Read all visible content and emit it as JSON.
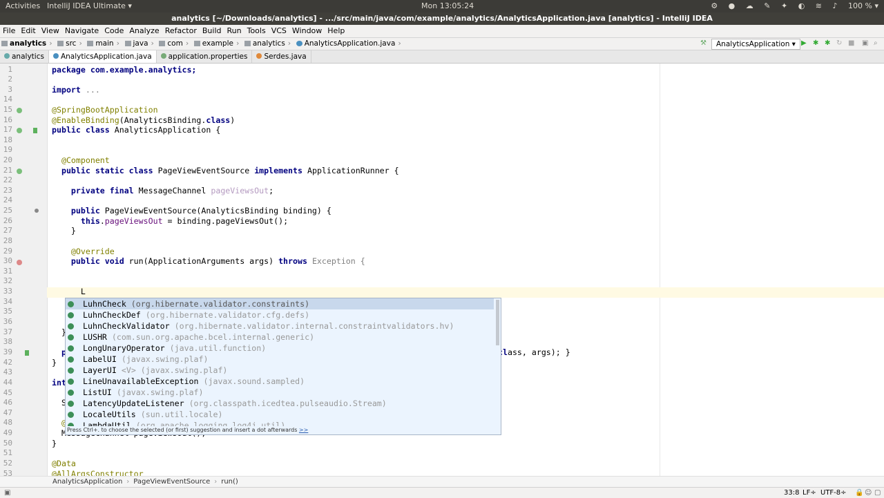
{
  "os_bar": {
    "activities": "Activities",
    "app": "IntelliJ IDEA Ultimate ▾",
    "clock": "Mon 13:05:24",
    "battery": "100 % ▾"
  },
  "window_title": "analytics [~/Downloads/analytics] - .../src/main/java/com/example/analytics/AnalyticsApplication.java [analytics] - IntelliJ IDEA",
  "menu": [
    "File",
    "Edit",
    "View",
    "Navigate",
    "Code",
    "Analyze",
    "Refactor",
    "Build",
    "Run",
    "Tools",
    "VCS",
    "Window",
    "Help"
  ],
  "breadcrumbs": [
    "analytics",
    "src",
    "main",
    "java",
    "com",
    "example",
    "analytics",
    "AnalyticsApplication.java"
  ],
  "run_config": "AnalyticsApplication ▾",
  "tabs": [
    {
      "label": "analytics"
    },
    {
      "label": "AnalyticsApplication.java"
    },
    {
      "label": "application.properties"
    },
    {
      "label": "Serdes.java"
    }
  ],
  "editor": {
    "line_numbers": [
      "1",
      "2",
      "3",
      "14",
      "15",
      "16",
      "17",
      "18",
      "19",
      "20",
      "21",
      "22",
      "23",
      "24",
      "25",
      "26",
      "27",
      "28",
      "29",
      "30",
      "31",
      "32",
      "33",
      "34",
      "35",
      "36",
      "37",
      "38",
      "39",
      "42",
      "43",
      "44",
      "45",
      "46",
      "47",
      "48",
      "49",
      "50",
      "51",
      "52",
      "53"
    ],
    "lines": {
      "l1": "package com.example.analytics;",
      "l3a": "import",
      "l3b": " ...",
      "l15": "@SpringBootApplication",
      "l16a": "@EnableBinding",
      "l16b": "(AnalyticsBinding.",
      "l16c": "class",
      "l16d": ")",
      "l17a": "public class",
      "l17b": " AnalyticsApplication {",
      "l20": "  @Component",
      "l21a": "  public static class",
      "l21b": " PageViewEventSource ",
      "l21c": "implements",
      "l21d": " ApplicationRunner {",
      "l23a": "    private final",
      "l23b": " MessageChannel ",
      "l23c": "pageViewsOut",
      "l23d": ";",
      "l25a": "    public",
      "l25b": " PageViewEventSource(AnalyticsBinding binding) {",
      "l26a": "      this",
      "l26b": ".",
      "l26c": "pageViewsOut",
      "l26d": " = binding.pageViewsOut();",
      "l27": "    }",
      "l29": "    @Override",
      "l30a": "    public void",
      "l30b": " run(ApplicationArguments args) ",
      "l30c": "throws",
      "l30d": " Exception {",
      "l33": "      L",
      "l37": "  }",
      "l39a": "  p",
      "l39b": "ass, args); }",
      "l42": "}",
      "l44": "int",
      "l46": "  S",
      "l48": "  @",
      "l49": "  MessageChannel pageViewsOut();",
      "l50": "}",
      "l52": "@Data",
      "l53": "@AllArgsConstructor"
    }
  },
  "completion": {
    "items": [
      {
        "name": "LuhnCheck",
        "pkg": "(org.hibernate.validator.constraints)"
      },
      {
        "name": "LuhnCheckDef",
        "pkg": "(org.hibernate.validator.cfg.defs)"
      },
      {
        "name": "LuhnCheckValidator",
        "pkg": "(org.hibernate.validator.internal.constraintvalidators.hv)"
      },
      {
        "name": "LUSHR",
        "pkg": "(com.sun.org.apache.bcel.internal.generic)"
      },
      {
        "name": "LongUnaryOperator",
        "pkg": "(java.util.function)"
      },
      {
        "name": "LabelUI",
        "pkg": "(javax.swing.plaf)"
      },
      {
        "name": "LayerUI",
        "pkg": "<V> (javax.swing.plaf)"
      },
      {
        "name": "LineUnavailableException",
        "pkg": "(javax.sound.sampled)"
      },
      {
        "name": "ListUI",
        "pkg": "(javax.swing.plaf)"
      },
      {
        "name": "LatencyUpdateListener",
        "pkg": "(org.classpath.icedtea.pulseaudio.Stream)"
      },
      {
        "name": "LocaleUtils",
        "pkg": "(sun.util.locale)"
      },
      {
        "name": "LambdaUtil",
        "pkg": "(org.apache.logging.log4j.util)"
      }
    ],
    "hint": "Press Ctrl+. to choose the selected (or first) suggestion and insert a dot afterwards",
    "hint_link": ">>"
  },
  "bottom_breadcrumb": [
    "AnalyticsApplication",
    "PageViewEventSource",
    "run()"
  ],
  "status": {
    "position": "33:8",
    "line_sep": "LF÷",
    "encoding": "UTF-8÷"
  }
}
